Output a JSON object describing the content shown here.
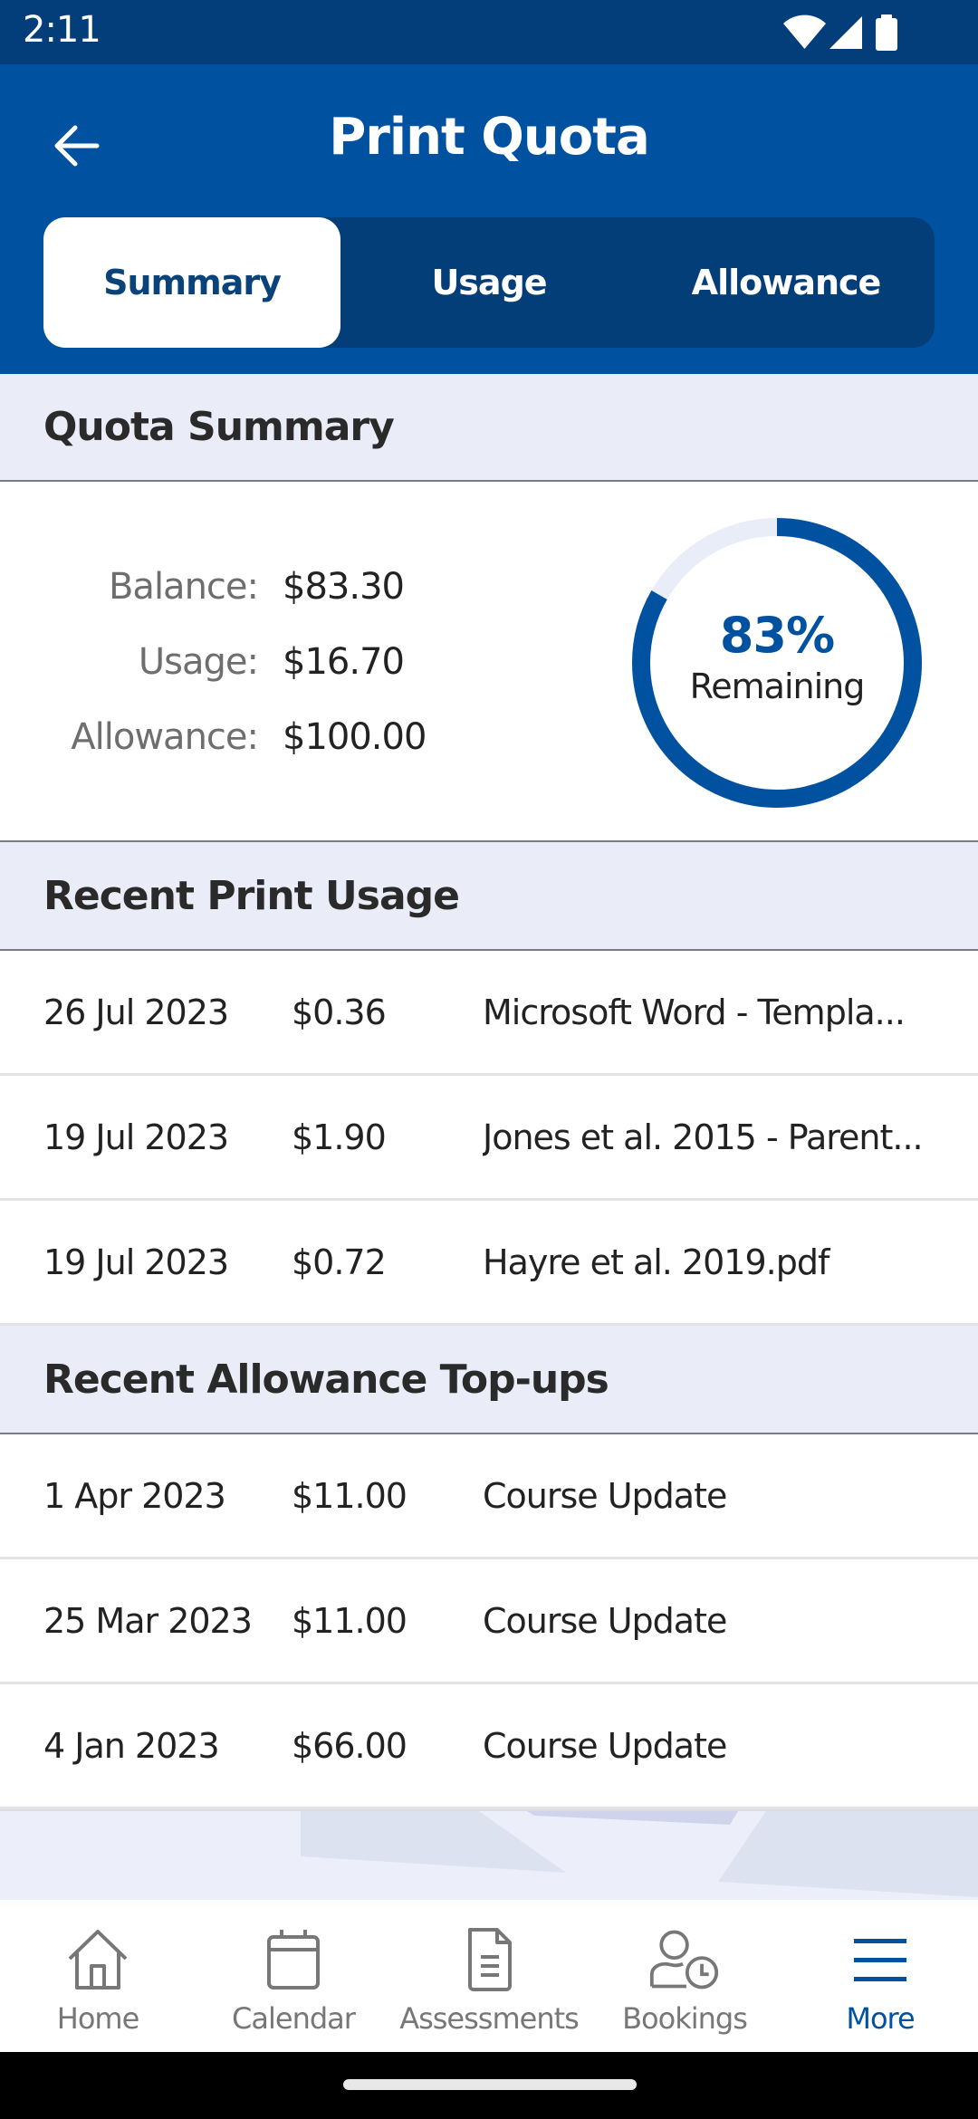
{
  "status_bar": {
    "time": "2:11",
    "icons": [
      "wifi-icon",
      "cellular-signal-icon",
      "battery-icon"
    ]
  },
  "header": {
    "title": "Print Quota",
    "back_icon": "arrow-left-icon"
  },
  "tabs": [
    {
      "label": "Summary",
      "active": true
    },
    {
      "label": "Usage",
      "active": false
    },
    {
      "label": "Allowance",
      "active": false
    }
  ],
  "quota_summary": {
    "heading": "Quota Summary",
    "rows": [
      {
        "label": "Balance:",
        "value": "$83.30"
      },
      {
        "label": "Usage:",
        "value": "$16.70"
      },
      {
        "label": "Allowance:",
        "value": "$100.00"
      }
    ],
    "ring": {
      "percent_text": "83%",
      "caption": "Remaining",
      "fraction_remaining": 0.833
    }
  },
  "recent_print_usage": {
    "heading": "Recent Print Usage",
    "rows": [
      {
        "date": "26 Jul 2023",
        "amount": "$0.36",
        "description": "Microsoft Word - Templa..."
      },
      {
        "date": "19 Jul 2023",
        "amount": "$1.90",
        "description": "Jones et al. 2015 - Parent..."
      },
      {
        "date": "19 Jul 2023",
        "amount": "$0.72",
        "description": "Hayre et al. 2019.pdf"
      }
    ]
  },
  "recent_allowance_topups": {
    "heading": "Recent Allowance Top-ups",
    "rows": [
      {
        "date": "1 Apr 2023",
        "amount": "$11.00",
        "description": "Course Update"
      },
      {
        "date": "25 Mar 2023",
        "amount": "$11.00",
        "description": "Course Update"
      },
      {
        "date": "4 Jan 2023",
        "amount": "$66.00",
        "description": "Course Update"
      }
    ]
  },
  "bottom_nav": [
    {
      "label": "Home",
      "icon": "home-icon",
      "active": false
    },
    {
      "label": "Calendar",
      "icon": "calendar-icon",
      "active": false
    },
    {
      "label": "Assessments",
      "icon": "document-icon",
      "active": false
    },
    {
      "label": "Bookings",
      "icon": "person-clock-icon",
      "active": false
    },
    {
      "label": "More",
      "icon": "menu-icon",
      "active": true
    }
  ],
  "colors": {
    "brand_blue": "#0052a0",
    "status_bar": "#033d7a",
    "tab_track": "#043e79",
    "section_bg": "#eaedf8",
    "ring_track": "#e8edf8",
    "nav_inactive": "#777777"
  }
}
